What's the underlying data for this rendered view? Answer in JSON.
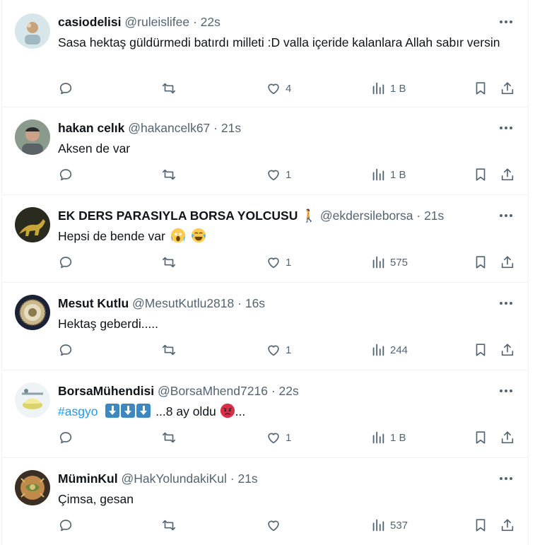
{
  "colors": {
    "text": "#0f1419",
    "secondary": "#536471",
    "link": "#1d9bf0",
    "divider": "#eff3f4"
  },
  "tweets": [
    {
      "name": "casiodelisi",
      "handle": "@ruleislifee",
      "dot": "·",
      "time": "22s",
      "text": "Sasa hektaş güldürmedi batırdı milleti :D valla içeride kalanlara Allah sabır versin",
      "replies": "",
      "retweets": "",
      "likes": "4",
      "views": "1 B"
    },
    {
      "name": "hakan celık",
      "handle": "@hakancelk67",
      "dot": "·",
      "time": "21s",
      "text": "Aksen de var",
      "replies": "",
      "retweets": "",
      "likes": "1",
      "views": "1 B"
    },
    {
      "name": "EK DERS PARASIYLA BORSA YOLCUSU",
      "name_emoji": "🚶",
      "handle": "@ekdersileborsa",
      "dot": "·",
      "time": "21s",
      "text": "Hepsi de bende var",
      "text_emojis": [
        "face-screaming-emoji",
        "face-with-tears-of-joy-emoji"
      ],
      "replies": "",
      "retweets": "",
      "likes": "1",
      "views": "575"
    },
    {
      "name": "Mesut Kutlu",
      "handle": "@MesutKutlu2818",
      "dot": "·",
      "time": "16s",
      "text": "Hektaş geberdi.....",
      "replies": "",
      "retweets": "",
      "likes": "1",
      "views": "244"
    },
    {
      "name": "BorsaMühendisi",
      "handle": "@BorsaMhend7216",
      "dot": "·",
      "time": "22s",
      "hashtag": "#asgyo",
      "text_after": " ...8 ay oldu ",
      "text_end": "...",
      "text_emojis": [
        "down-arrow-emoji",
        "down-arrow-emoji",
        "down-arrow-emoji",
        "angry-face-emoji"
      ],
      "replies": "",
      "retweets": "",
      "likes": "1",
      "views": "1 B"
    },
    {
      "name": "MüminKul",
      "handle": "@HakYolundakiKul",
      "dot": "·",
      "time": "21s",
      "text": "Çimsa, gesan",
      "replies": "",
      "retweets": "",
      "likes": "",
      "views": "537"
    }
  ]
}
